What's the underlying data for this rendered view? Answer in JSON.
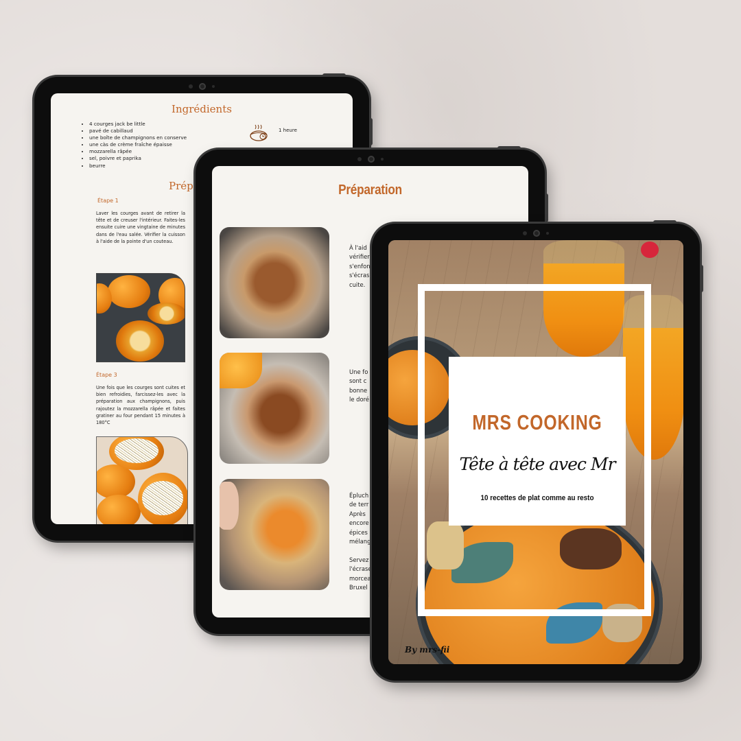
{
  "ingredients_page": {
    "title": "Ingrédients",
    "items": [
      "4 courges jack be little",
      "pavé de cabillaud",
      "une boîte de champignons en conserve",
      "une càs de crème fraîche épaisse",
      "mozzarella râpée",
      "sel, poivre et paprika",
      "beurre"
    ],
    "time_icon": "cooking-pot-timer-icon",
    "time": "1 heure",
    "section_partial": "Prépa",
    "steps": [
      {
        "title": "Étape 1",
        "text": "Laver les courges avant de retirer la tête et de creuser l'intérieur. Faites-les ensuite cuire une vingtaine de minutes dans de l'eau salée. Vérifier la cuisson à l'aide de la pointe d'un couteau."
      },
      {
        "title": "Étape 3",
        "text": "Une fois que les courges sont cuites et bien refroidies, farcissez-les avec la préparation aux champignons, puis rajoutez la mozzarella râpée et faites gratiner au four pendant 15 minutes à 180°C"
      }
    ]
  },
  "preparation_page": {
    "title": "Préparation",
    "paragraphs": [
      "À  l'aid\nvérifier\ns'enfon\ns'écras\ncuite.",
      "Une  fo\nsont  c\nbonne\nle doré",
      "Épluch\nde terr\nAprès\nencore\népices\nmélang\n\nServez\nl'écrase\nmorcea\nBruxel"
    ]
  },
  "cover_page": {
    "brand": "MRS COOKING",
    "tagline": "Tête à tête avec Mr",
    "subtitle": "10 recettes de plat comme au resto",
    "signature": "By mrs-fii"
  },
  "colors": {
    "accent": "#c2672a",
    "background": "#e4dedb",
    "tablet_bezel": "#0d0d0d"
  }
}
